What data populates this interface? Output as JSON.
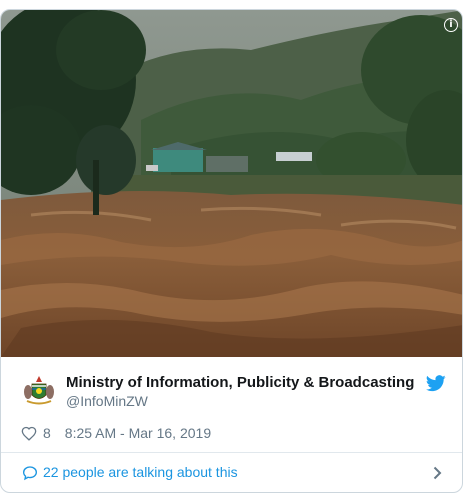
{
  "tweet": {
    "author_name": "Ministry of Information, Publicity & Broadcasting",
    "author_handle": "@InfoMinZW",
    "like_count": "8",
    "timestamp": "8:25 AM - Mar 16, 2019",
    "conversation_label": "22 people are talking about this",
    "media_description_icon": "info-icon",
    "brand_icon": "twitter-bird-icon"
  },
  "colors": {
    "twitter_blue": "#1da1f2",
    "link_blue": "#1b95e0",
    "muted_text": "#657786",
    "border": "#ccd6dd"
  }
}
